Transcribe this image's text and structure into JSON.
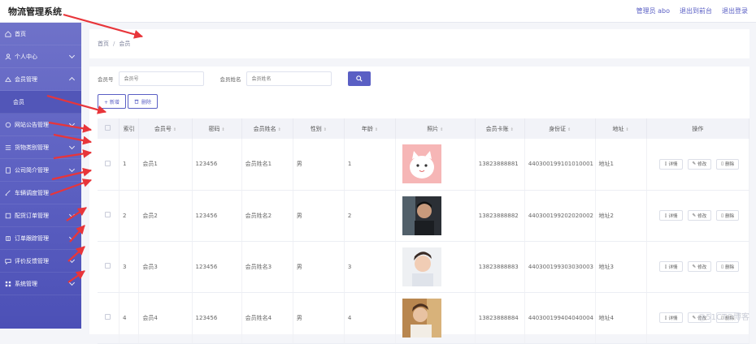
{
  "app": {
    "title": "物流管理系统"
  },
  "topbar": {
    "user": "管理员 abo",
    "back_front": "退出到前台",
    "logout": "退出登录"
  },
  "sidebar": {
    "items": [
      {
        "label": "首页",
        "icon": "home-icon",
        "chevron": ""
      },
      {
        "label": "个人中心",
        "icon": "user-icon",
        "chevron": "down"
      },
      {
        "label": "会员管理",
        "icon": "member-icon",
        "chevron": "up"
      },
      {
        "label": "会员",
        "icon": "",
        "chevron": "",
        "sub": true
      },
      {
        "label": "网站公告管理",
        "icon": "notice-icon",
        "chevron": "down"
      },
      {
        "label": "货物类别管理",
        "icon": "list-icon",
        "chevron": "down"
      },
      {
        "label": "公司简介管理",
        "icon": "company-icon",
        "chevron": "down"
      },
      {
        "label": "车辆调度管理",
        "icon": "truck-icon",
        "chevron": ""
      },
      {
        "label": "配货订单管理",
        "icon": "order-icon",
        "chevron": "down"
      },
      {
        "label": "订单跟踪管理",
        "icon": "track-icon",
        "chevron": "down"
      },
      {
        "label": "评价反馈管理",
        "icon": "feedback-icon",
        "chevron": "down"
      },
      {
        "label": "系统管理",
        "icon": "system-icon",
        "chevron": "down"
      }
    ]
  },
  "breadcrumb": {
    "home": "首页",
    "sep": "/",
    "current": "会员"
  },
  "search": {
    "account_label": "会员号",
    "account_placeholder": "会员号",
    "name_label": "会员姓名",
    "name_placeholder": "会员姓名"
  },
  "actions": {
    "add": "+ 新增",
    "delete": "删除"
  },
  "table": {
    "headers": [
      "",
      "索引",
      "会员号",
      "密码",
      "会员姓名",
      "性别",
      "年龄",
      "照片",
      "会员卡账",
      "身份证",
      "地址",
      "操作"
    ],
    "rows": [
      {
        "index": "1",
        "account": "会员1",
        "password": "123456",
        "name": "会员姓名1",
        "gender": "男",
        "age": "1",
        "photo": "cat-cartoon",
        "card": "13823888881",
        "id_card": "440300199101010001",
        "address": "地址1"
      },
      {
        "index": "2",
        "account": "会员2",
        "password": "123456",
        "name": "会员姓名2",
        "gender": "男",
        "age": "2",
        "photo": "portrait-dark",
        "card": "13823888882",
        "id_card": "440300199202020002",
        "address": "地址2"
      },
      {
        "index": "3",
        "account": "会员3",
        "password": "123456",
        "name": "会员姓名3",
        "gender": "男",
        "age": "3",
        "photo": "portrait-light",
        "card": "13823888883",
        "id_card": "440300199303030003",
        "address": "地址3"
      },
      {
        "index": "4",
        "account": "会员4",
        "password": "123456",
        "name": "会员姓名4",
        "gender": "男",
        "age": "4",
        "photo": "portrait-warm",
        "card": "13823888884",
        "id_card": "440300199404040004",
        "address": "地址4"
      }
    ],
    "ops": {
      "detail": "详情",
      "edit": "修改",
      "delete": "删除"
    }
  },
  "watermark": "@51CTO博客",
  "colors": {
    "accent": "#5a5fc4",
    "sidebar_top": "#6f72c9",
    "sidebar_bottom": "#4c50b6",
    "arrow": "#e8353a"
  }
}
